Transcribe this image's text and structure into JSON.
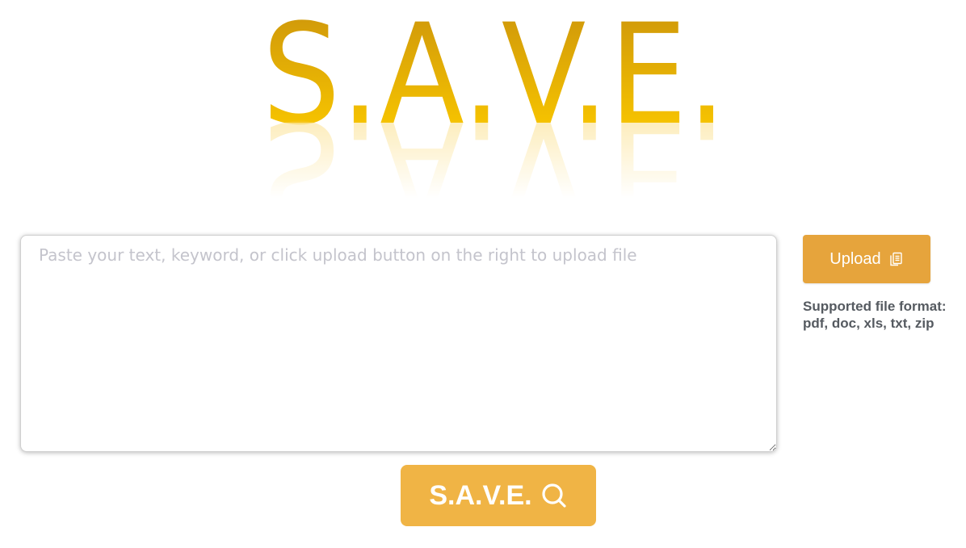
{
  "logo": {
    "text": "S.A.V.E.",
    "colors": {
      "top": "#d19a0a",
      "bottom": "#f5c200"
    }
  },
  "input": {
    "placeholder": "Paste your text, keyword, or click upload button on the right to upload file",
    "value": ""
  },
  "upload": {
    "label": "Upload",
    "icon": "copy-icon",
    "color": "#e6a43c"
  },
  "formats": {
    "line1": "Supported file format:",
    "line2": "pdf, doc, xls, txt, zip"
  },
  "search": {
    "label": "S.A.V.E.",
    "icon": "search-icon",
    "color": "#f0b445"
  }
}
